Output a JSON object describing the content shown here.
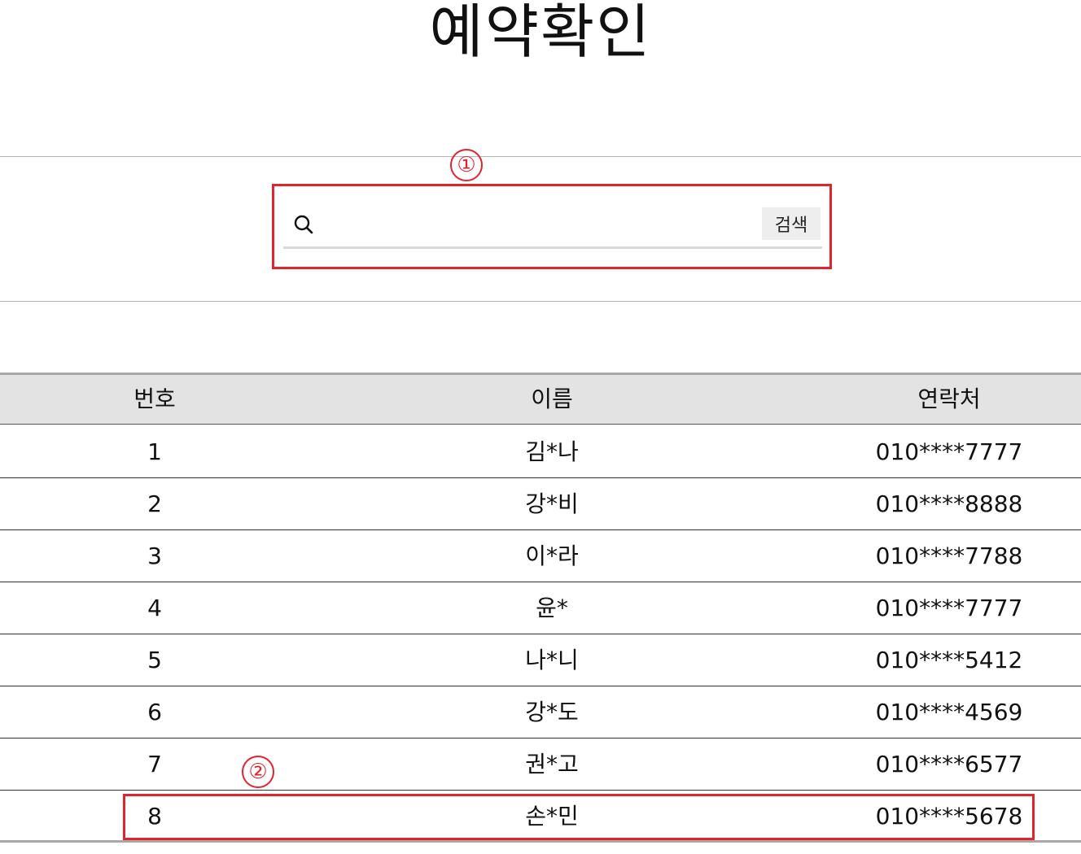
{
  "page": {
    "title": "예약확인"
  },
  "annotations": {
    "marker_1": "①",
    "marker_2": "②",
    "accent_color": "#e0242e"
  },
  "search": {
    "value": "",
    "placeholder": "",
    "icon": "search-icon",
    "button_label": "검색"
  },
  "table": {
    "headers": {
      "num": "번호",
      "name": "이름",
      "phone": "연락처"
    },
    "rows": [
      {
        "num": "1",
        "name": "김*나",
        "phone": "010****7777"
      },
      {
        "num": "2",
        "name": "강*비",
        "phone": "010****8888"
      },
      {
        "num": "3",
        "name": "이*라",
        "phone": "010****7788"
      },
      {
        "num": "4",
        "name": "윤*",
        "phone": "010****7777"
      },
      {
        "num": "5",
        "name": "나*니",
        "phone": "010****5412"
      },
      {
        "num": "6",
        "name": "강*도",
        "phone": "010****4569"
      },
      {
        "num": "7",
        "name": "권*고",
        "phone": "010****6577"
      },
      {
        "num": "8",
        "name": "손*민",
        "phone": "010****5678"
      }
    ]
  }
}
